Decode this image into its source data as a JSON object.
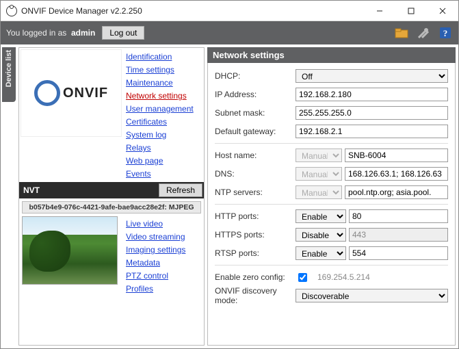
{
  "window": {
    "title": "ONVIF Device Manager v2.2.250"
  },
  "toolbar": {
    "login_prefix": "You logged in as",
    "user": "admin",
    "logout_label": "Log out"
  },
  "sidetab": {
    "label": "Device list"
  },
  "device": {
    "menu": [
      "Identification",
      "Time settings",
      "Maintenance",
      "Network settings",
      "User management",
      "Certificates",
      "System log",
      "Relays",
      "Web page",
      "Events"
    ],
    "active_menu_index": 3,
    "nvt_label": "NVT",
    "refresh_label": "Refresh",
    "profile_id": "b057b4e9-076c-4421-9afe-bae9acc28e2f: MJPEG",
    "submenu": [
      "Live video",
      "Video streaming",
      "Imaging settings",
      "Metadata",
      "PTZ control",
      "Profiles"
    ]
  },
  "network": {
    "header": "Network settings",
    "labels": {
      "dhcp": "DHCP:",
      "ip": "IP Address:",
      "subnet": "Subnet mask:",
      "gateway": "Default gateway:",
      "host": "Host name:",
      "dns": "DNS:",
      "ntp": "NTP servers:",
      "http": "HTTP ports:",
      "https": "HTTPS ports:",
      "rtsp": "RTSP ports:",
      "zero": "Enable zero config:",
      "discovery": "ONVIF discovery mode:"
    },
    "values": {
      "dhcp": "Off",
      "ip": "192.168.2.180",
      "subnet": "255.255.255.0",
      "gateway": "192.168.2.1",
      "host_mode": "Manual",
      "host_value": "SNB-6004",
      "dns_mode": "Manual",
      "dns_value": "168.126.63.1; 168.126.63",
      "ntp_mode": "Manual",
      "ntp_value": "pool.ntp.org; asia.pool.",
      "http_mode": "Enable",
      "http_value": "80",
      "https_mode": "Disable",
      "https_value": "443",
      "rtsp_mode": "Enable",
      "rtsp_value": "554",
      "zero_checked": true,
      "zero_ip": "169.254.5.214",
      "discovery": "Discoverable"
    }
  },
  "logo_text": "ONVIF"
}
